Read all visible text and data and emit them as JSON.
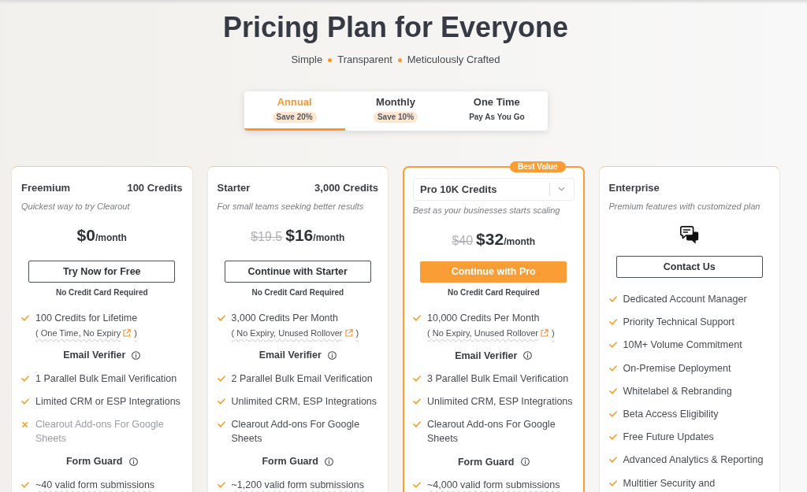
{
  "title": "Pricing Plan for Everyone",
  "tagline": [
    "Simple",
    "Transparent",
    "Meticulously Crafted"
  ],
  "tabs": [
    {
      "label": "Annual",
      "badge": "Save 20%",
      "selected": true
    },
    {
      "label": "Monthly",
      "badge": "Save 10%",
      "selected": false
    },
    {
      "label": "One Time",
      "caption": "Pay As You Go",
      "selected": false
    }
  ],
  "plans": [
    {
      "kind": "priced",
      "highlighted": false,
      "header": {
        "kind": "title",
        "name": "Freemium",
        "credits": "100 Credits"
      },
      "description": "Quickest way to try Clearout",
      "price": {
        "amount": "$0",
        "period": "/month"
      },
      "button": {
        "label": "Try Now for Free",
        "primary": false
      },
      "note": "No Credit Card Required",
      "features": [
        {
          "kind": "feature",
          "label": "100 Credits for Lifetime",
          "included": true,
          "underlined": false,
          "note": "( One Time, No Expiry",
          "note_end": ")"
        },
        {
          "kind": "section",
          "label": "Email Verifier"
        },
        {
          "kind": "feature",
          "label": "1 Parallel Bulk Email Verification",
          "included": true,
          "underlined": false
        },
        {
          "kind": "feature",
          "label": "Limited CRM or ESP Integrations",
          "included": true,
          "underlined": false
        },
        {
          "kind": "feature",
          "label": "Clearout Add-ons For Google Sheets",
          "included": false,
          "underlined": false
        },
        {
          "kind": "section",
          "label": "Form Guard"
        },
        {
          "kind": "feature",
          "label": "~40 valid form submissions",
          "included": true,
          "underlined": true
        }
      ]
    },
    {
      "kind": "priced",
      "highlighted": false,
      "header": {
        "kind": "title",
        "name": "Starter",
        "credits": "3,000 Credits"
      },
      "description": "For small teams seeking better results",
      "price": {
        "old": "$19.5",
        "amount": "$16",
        "period": "/month"
      },
      "button": {
        "label": "Continue with Starter",
        "primary": false
      },
      "note": "No Credit Card Required",
      "features": [
        {
          "kind": "feature",
          "label": "3,000 Credits Per Month",
          "included": true,
          "underlined": false,
          "note": "( No Expiry, Unused Rollover",
          "note_end": ")"
        },
        {
          "kind": "section",
          "label": "Email Verifier"
        },
        {
          "kind": "feature",
          "label": "2 Parallel Bulk Email Verification",
          "included": true,
          "underlined": false
        },
        {
          "kind": "feature",
          "label": "Unlimited CRM, ESP Integrations",
          "included": true,
          "underlined": false
        },
        {
          "kind": "feature",
          "label": "Clearout Add-ons For Google Sheets",
          "included": true,
          "underlined": false
        },
        {
          "kind": "section",
          "label": "Form Guard"
        },
        {
          "kind": "feature",
          "label": "~1,200 valid form submissions",
          "included": true,
          "underlined": true
        }
      ]
    },
    {
      "kind": "priced",
      "highlighted": true,
      "badge": "Best Value",
      "header": {
        "kind": "select",
        "value": "Pro 10K Credits"
      },
      "description": "Best as your businesses starts scaling",
      "price": {
        "old": "$40",
        "amount": "$32",
        "period": "/month"
      },
      "button": {
        "label": "Continue with Pro",
        "primary": true
      },
      "note": "No Credit Card Required",
      "features": [
        {
          "kind": "feature",
          "label": "10,000 Credits Per Month",
          "included": true,
          "underlined": false,
          "note": "( No Expiry, Unused Rollover",
          "note_end": ")"
        },
        {
          "kind": "section",
          "label": "Email Verifier"
        },
        {
          "kind": "feature",
          "label": "3 Parallel Bulk Email Verification",
          "included": true,
          "underlined": false
        },
        {
          "kind": "feature",
          "label": "Unlimited CRM, ESP Integrations",
          "included": true,
          "underlined": false
        },
        {
          "kind": "feature",
          "label": "Clearout Add-ons For Google Sheets",
          "included": true,
          "underlined": false
        },
        {
          "kind": "section",
          "label": "Form Guard"
        },
        {
          "kind": "feature",
          "label": "~4,000 valid form submissions",
          "included": true,
          "underlined": true
        }
      ]
    },
    {
      "kind": "contact",
      "highlighted": false,
      "header": {
        "kind": "title",
        "name": "Enterprise"
      },
      "description": "Premium features with customized plan",
      "button": {
        "label": "Contact Us",
        "primary": false
      },
      "features": [
        {
          "kind": "feature",
          "label": "Dedicated Account Manager",
          "included": true,
          "underlined": false
        },
        {
          "kind": "feature",
          "label": "Priority Technical Support",
          "included": true,
          "underlined": false
        },
        {
          "kind": "feature",
          "label": "10M+ Volume Commitment",
          "included": true,
          "underlined": false
        },
        {
          "kind": "feature",
          "label": "On-Premise Deployment",
          "included": true,
          "underlined": false
        },
        {
          "kind": "feature",
          "label": "Whitelabel & Rebranding",
          "included": true,
          "underlined": false
        },
        {
          "kind": "feature",
          "label": "Beta Access Eligibility",
          "included": true,
          "underlined": false
        },
        {
          "kind": "feature",
          "label": "Free Future Updates",
          "included": true,
          "underlined": false
        },
        {
          "kind": "feature",
          "label": "Advanced Analytics & Reporting",
          "included": true,
          "underlined": false
        },
        {
          "kind": "feature",
          "label": "Multitier Security and",
          "included": true,
          "underlined": false
        }
      ]
    }
  ]
}
